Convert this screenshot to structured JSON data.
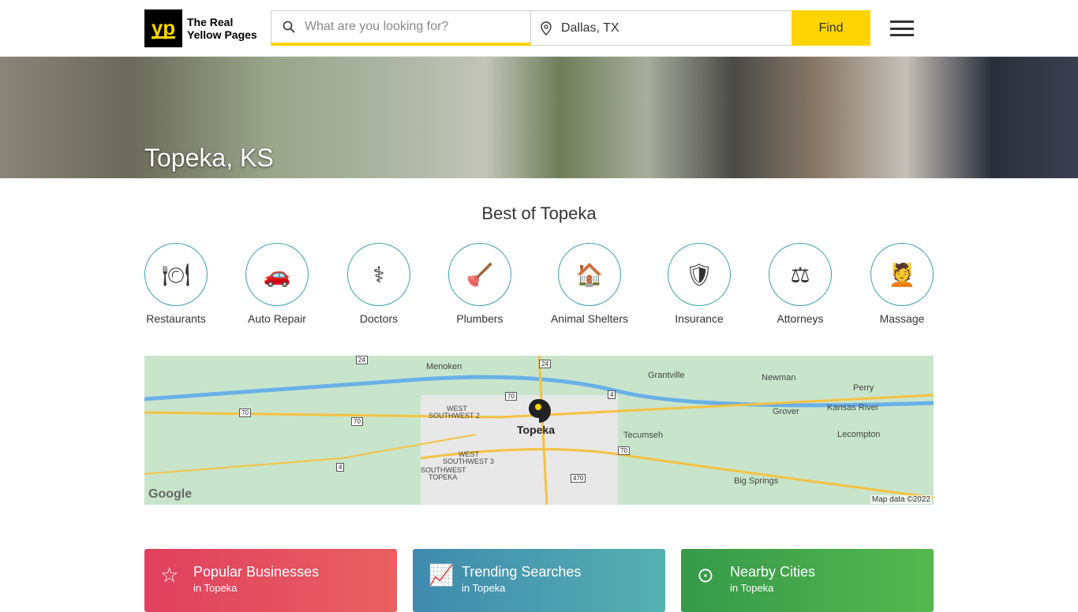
{
  "header": {
    "logo_mark": "yp",
    "logo_line1": "The Real",
    "logo_line2": "Yellow Pages",
    "search_placeholder": "What are you looking for?",
    "location_value": "Dallas, TX",
    "find_label": "Find"
  },
  "hero": {
    "title": "Topeka, KS"
  },
  "best": {
    "title": "Best of Topeka",
    "categories": [
      {
        "label": "Restaurants",
        "icon": "🍽"
      },
      {
        "label": "Auto Repair",
        "icon": "🚗"
      },
      {
        "label": "Doctors",
        "icon": "⚕"
      },
      {
        "label": "Plumbers",
        "icon": "🪠"
      },
      {
        "label": "Animal Shelters",
        "icon": "🏠"
      },
      {
        "label": "Insurance",
        "icon": "🛡"
      },
      {
        "label": "Attorneys",
        "icon": "⚖"
      },
      {
        "label": "Massage",
        "icon": "💆"
      }
    ]
  },
  "map": {
    "city": "Topeka",
    "places": [
      "Menoken",
      "Grantville",
      "Newman",
      "Perry",
      "Grover",
      "Lecompton",
      "Tecumseh",
      "Big Springs",
      "WEST",
      "SOUTHWEST 2",
      "WEST",
      "SOUTHWEST 3",
      "SOUTHWEST",
      "TOPEKA",
      "Kansas River"
    ],
    "shields": [
      "24",
      "24",
      "70",
      "70",
      "70",
      "70",
      "4",
      "4",
      "470"
    ],
    "google": "Google",
    "attribution": "Map data ©2022"
  },
  "cards": [
    {
      "title": "Popular Businesses",
      "sub": "in Topeka",
      "color1": "#e0405f",
      "color2": "#e86060"
    },
    {
      "title": "Trending Searches",
      "sub": "in Topeka",
      "color1": "#3f8aae",
      "color2": "#56b0b0"
    },
    {
      "title": "Nearby Cities",
      "sub": "in Topeka",
      "color1": "#36994a",
      "color2": "#55b84f"
    }
  ]
}
